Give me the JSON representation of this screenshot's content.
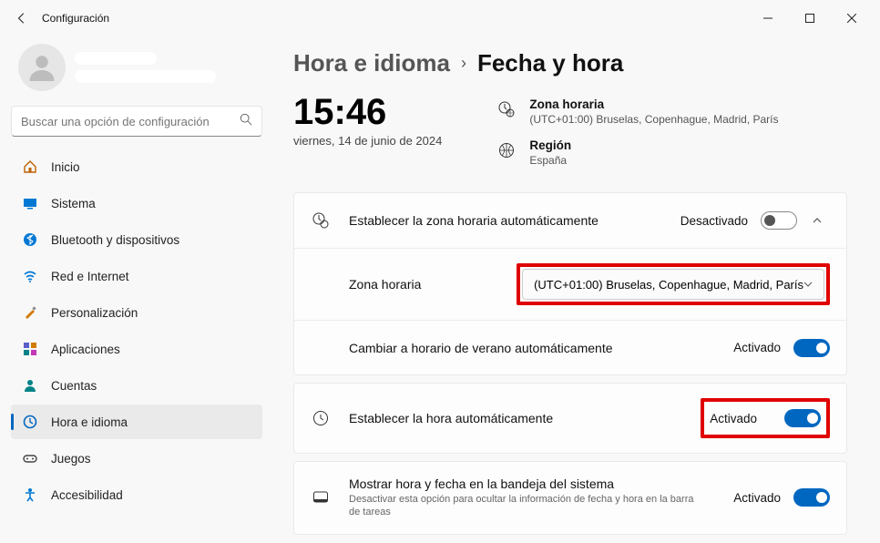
{
  "window": {
    "title": "Configuración"
  },
  "search": {
    "placeholder": "Buscar una opción de configuración"
  },
  "nav": {
    "items": [
      {
        "label": "Inicio"
      },
      {
        "label": "Sistema"
      },
      {
        "label": "Bluetooth y dispositivos"
      },
      {
        "label": "Red e Internet"
      },
      {
        "label": "Personalización"
      },
      {
        "label": "Aplicaciones"
      },
      {
        "label": "Cuentas"
      },
      {
        "label": "Hora e idioma"
      },
      {
        "label": "Juegos"
      },
      {
        "label": "Accesibilidad"
      }
    ]
  },
  "breadcrumb": {
    "a": "Hora e idioma",
    "b": "Fecha y hora"
  },
  "clock": {
    "time": "15:46",
    "date": "viernes, 14 de junio de 2024"
  },
  "meta": {
    "tz": {
      "label": "Zona horaria",
      "value": "(UTC+01:00) Bruselas, Copenhague, Madrid, París"
    },
    "region": {
      "label": "Región",
      "value": "España"
    }
  },
  "settings": {
    "auto_tz": {
      "label": "Establecer la zona horaria automáticamente",
      "state": "Desactivado"
    },
    "tz_row": {
      "label": "Zona horaria",
      "value": "(UTC+01:00) Bruselas, Copenhague, Madrid, París"
    },
    "dst": {
      "label": "Cambiar a horario de verano automáticamente",
      "state": "Activado"
    },
    "auto_time": {
      "label": "Establecer la hora automáticamente",
      "state": "Activado"
    },
    "tray": {
      "label": "Mostrar hora y fecha en la bandeja del sistema",
      "sub": "Desactivar esta opción para ocultar la información de fecha y hora en la barra de tareas",
      "state": "Activado"
    }
  }
}
